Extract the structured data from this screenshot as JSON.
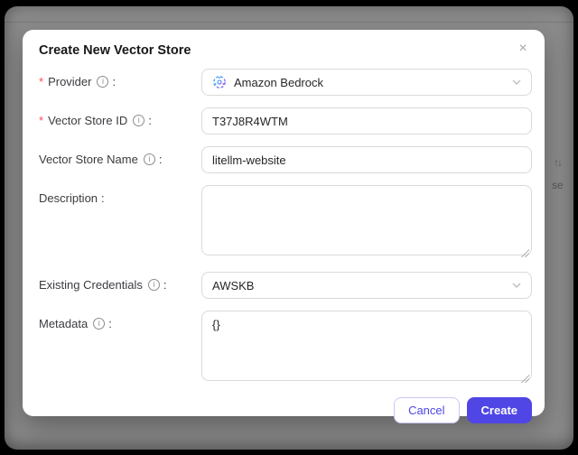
{
  "modal": {
    "title": "Create New Vector Store",
    "close_icon": "×",
    "required_marker": "*",
    "label_colon": ":",
    "info_glyph": "i",
    "fields": [
      {
        "label": "Provider",
        "required": true,
        "has_info": true,
        "type": "select",
        "value": "Amazon Bedrock",
        "icon": "amazon-bedrock-icon"
      },
      {
        "label": "Vector Store ID",
        "required": true,
        "has_info": true,
        "type": "input",
        "value": "T37J8R4WTM"
      },
      {
        "label": "Vector Store Name",
        "required": false,
        "has_info": true,
        "type": "input",
        "value": "litellm-website"
      },
      {
        "label": "Description",
        "required": false,
        "has_info": false,
        "type": "textarea",
        "value": ""
      },
      {
        "label": "Existing Credentials",
        "required": false,
        "has_info": true,
        "type": "select",
        "value": "AWSKB"
      },
      {
        "label": "Metadata",
        "required": false,
        "has_info": true,
        "type": "textarea",
        "value": "{}"
      }
    ],
    "footer": {
      "cancel_label": "Cancel",
      "create_label": "Create"
    }
  },
  "backdrop": {
    "sort_icon": "↑↓",
    "partial_text": "se"
  },
  "colors": {
    "accent": "#4f46e5",
    "required_red": "#ff4d4f",
    "backdrop_gray": "#8b8b8b",
    "input_border": "#d9d9d9"
  }
}
